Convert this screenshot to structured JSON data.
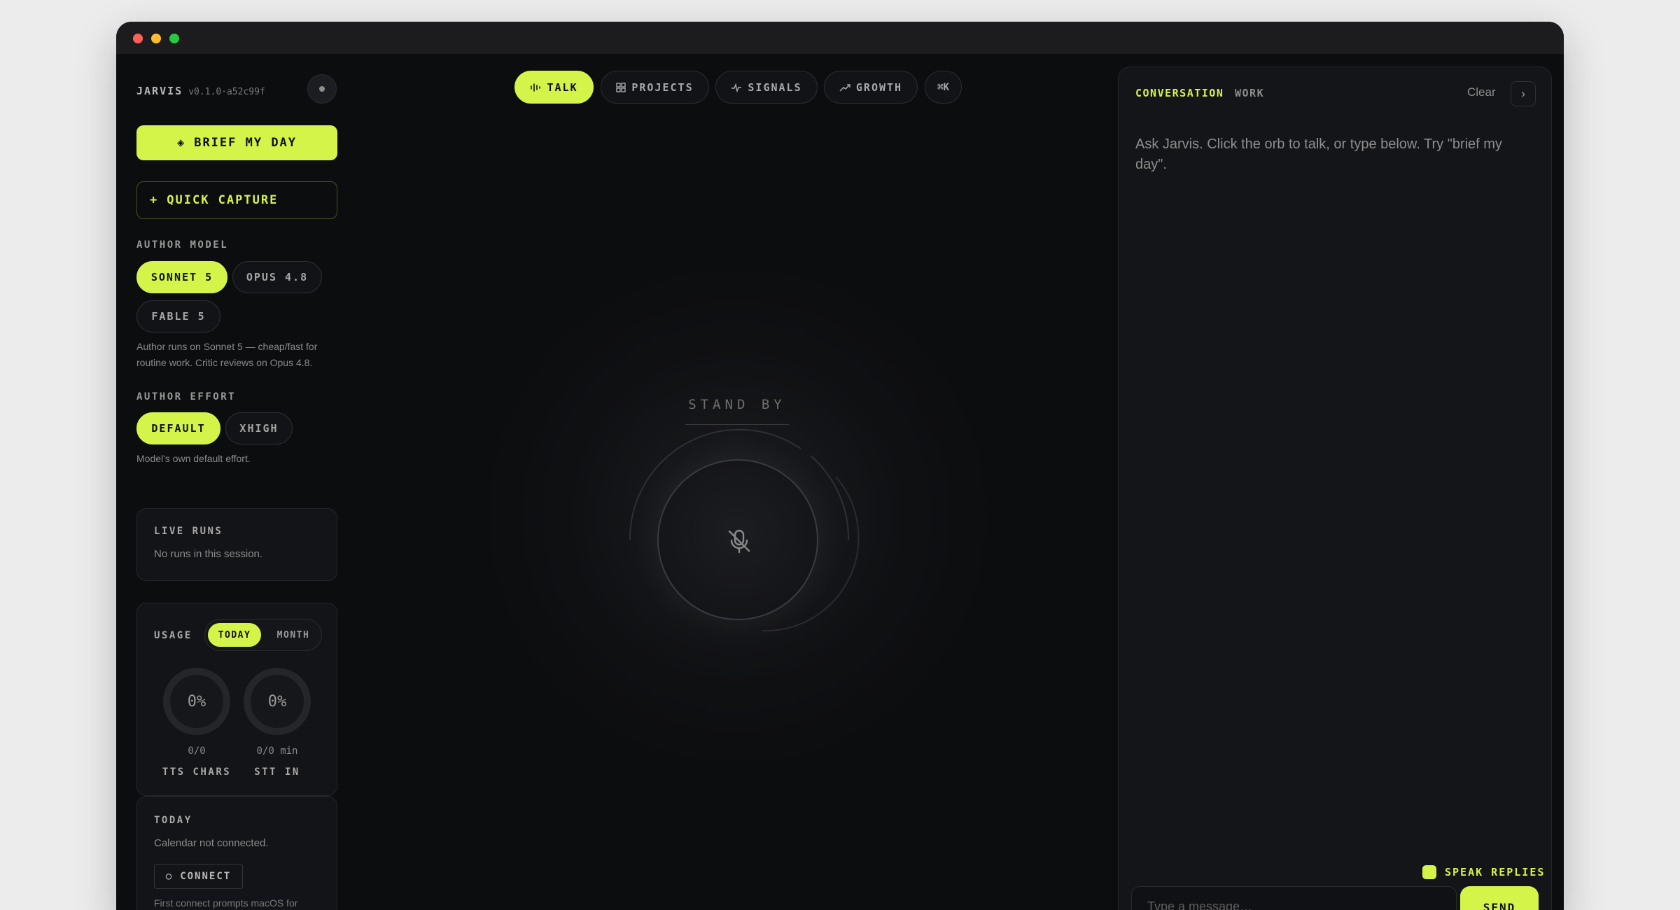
{
  "sidebar": {
    "brand": "JARVIS",
    "version": "v0.1.0·a52c99f",
    "brief_label": "BRIEF MY DAY",
    "brief_icon": "◈",
    "capture_label": "QUICK CAPTURE",
    "capture_icon": "+",
    "author_model": {
      "label": "AUTHOR MODEL",
      "options": [
        "SONNET 5",
        "OPUS 4.8",
        "FABLE 5"
      ],
      "selected": "SONNET 5",
      "note": "Author runs on Sonnet 5 — cheap/fast for routine work. Critic reviews on Opus 4.8."
    },
    "author_effort": {
      "label": "AUTHOR EFFORT",
      "options": [
        "DEFAULT",
        "XHIGH"
      ],
      "selected": "DEFAULT",
      "note": "Model's own default effort."
    },
    "live_runs": {
      "title": "LIVE RUNS",
      "text": "No runs in this session."
    },
    "usage": {
      "title": "USAGE",
      "periods": [
        "TODAY",
        "MONTH"
      ],
      "selected": "TODAY",
      "gauges": [
        {
          "percent": "0%",
          "detail": "0/0",
          "name": "TTS CHARS",
          "fraction": 0
        },
        {
          "percent": "0%",
          "detail": "0/0 min",
          "name": "STT IN",
          "fraction": 0
        }
      ]
    },
    "today": {
      "title": "TODAY",
      "text": "Calendar not connected.",
      "connect_label": "CONNECT",
      "connect_icon": "○",
      "footnote": "First connect prompts macOS for"
    }
  },
  "nav": {
    "tabs": [
      {
        "label": "TALK",
        "icon": "waveform-icon"
      },
      {
        "label": "PROJECTS",
        "icon": "grid-icon"
      },
      {
        "label": "SIGNALS",
        "icon": "pulse-icon"
      },
      {
        "label": "GROWTH",
        "icon": "trend-icon"
      }
    ],
    "active": "TALK",
    "shortcut": "⌘K"
  },
  "orb": {
    "status": "STAND BY",
    "icon": "mic-off-icon"
  },
  "panel": {
    "tabs": [
      "CONVERSATION",
      "WORK"
    ],
    "active": "CONVERSATION",
    "clear_label": "Clear",
    "collapse_icon": "›",
    "hint": "Ask Jarvis. Click the orb to talk, or type below. Try \"brief my day\".",
    "speak_label": "SPEAK REPLIES",
    "speak_enabled": true,
    "input_placeholder": "Type a message…",
    "send_label": "SEND"
  },
  "colors": {
    "accent": "#d4f44a",
    "background": "#0c0d0f",
    "panel": "#141518"
  }
}
